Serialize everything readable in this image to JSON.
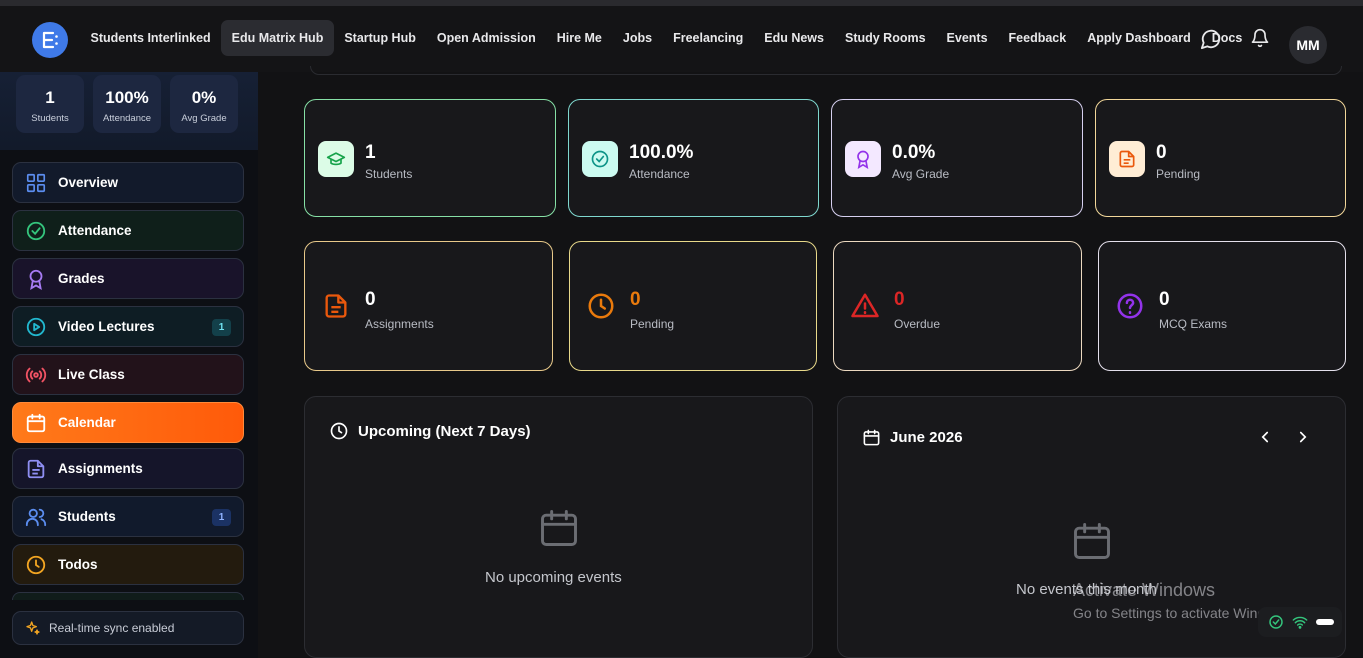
{
  "nav": {
    "links": [
      "Students Interlinked",
      "Edu Matrix Hub",
      "Startup Hub",
      "Open Admission",
      "Hire Me",
      "Jobs",
      "Freelancing",
      "Edu News",
      "Study Rooms",
      "Events",
      "Feedback",
      "Apply Dashboard",
      "Docs"
    ],
    "active_link": "Edu Matrix Hub",
    "avatar_initials": "MM",
    "icons": [
      "message-icon",
      "bell-icon"
    ]
  },
  "sidebar": {
    "stats": [
      {
        "value": "1",
        "label": "Students"
      },
      {
        "value": "100%",
        "label": "Attendance"
      },
      {
        "value": "0%",
        "label": "Avg Grade"
      }
    ],
    "items": [
      {
        "label": "Overview",
        "icon": "grid-icon",
        "color": "#5b8def"
      },
      {
        "label": "Attendance",
        "icon": "check-circle-icon",
        "color": "#34c47c"
      },
      {
        "label": "Grades",
        "icon": "award-icon",
        "color": "#a77bf3"
      },
      {
        "label": "Video Lectures",
        "icon": "play-circle-icon",
        "color": "#22b8cf",
        "badge": "1"
      },
      {
        "label": "Live Class",
        "icon": "broadcast-icon",
        "color": "#f05263"
      },
      {
        "label": "Calendar",
        "icon": "calendar-icon",
        "color": "#ff7a1a",
        "active": true
      },
      {
        "label": "Assignments",
        "icon": "file-icon",
        "color": "#8f8ff3"
      },
      {
        "label": "Students",
        "icon": "users-icon",
        "color": "#5b8def",
        "badge": "1"
      },
      {
        "label": "Todos",
        "icon": "clock-icon",
        "color": "#f2a522"
      }
    ],
    "sync_label": "Real-time sync enabled"
  },
  "stats_row1": [
    {
      "value": "1",
      "label": "Students",
      "icon": "graduation-cap-icon",
      "accent": "#22c55e"
    },
    {
      "value": "100.0%",
      "label": "Attendance",
      "icon": "check-circle-icon",
      "accent": "#14b8a6"
    },
    {
      "value": "0.0%",
      "label": "Avg Grade",
      "icon": "award-icon",
      "accent": "#a855f7"
    },
    {
      "value": "0",
      "label": "Pending",
      "icon": "file-text-icon",
      "accent": "#f97316"
    }
  ],
  "stats_row2": [
    {
      "value": "0",
      "label": "Assignments",
      "icon": "file-text-icon",
      "accent": "#ea580c"
    },
    {
      "value": "0",
      "label": "Pending",
      "icon": "clock-icon",
      "accent": "#ea7a0c"
    },
    {
      "value": "0",
      "label": "Overdue",
      "icon": "alert-triangle-icon",
      "accent": "#dc2626"
    },
    {
      "value": "0",
      "label": "MCQ Exams",
      "icon": "help-circle-icon",
      "accent": "#9333ea"
    }
  ],
  "upcoming": {
    "title": "Upcoming (Next 7 Days)",
    "empty": "No upcoming events"
  },
  "calendar": {
    "month": "June 2026",
    "empty": "No events this month"
  },
  "watermark": {
    "line1": "Activate Windows",
    "line2": "Go to Settings to activate Windows."
  }
}
